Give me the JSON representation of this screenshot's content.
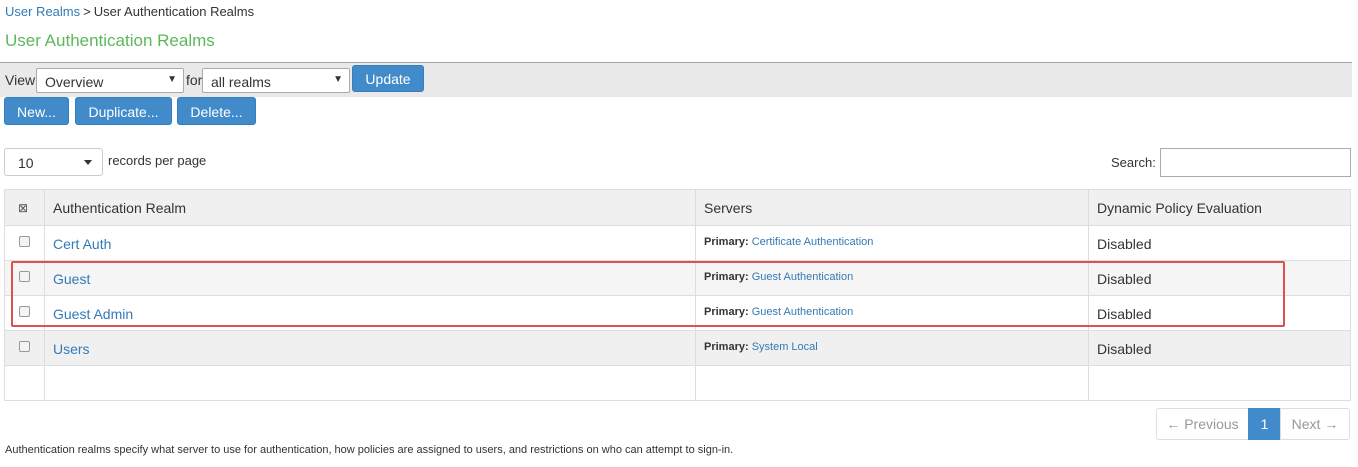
{
  "breadcrumb": {
    "root": "User Realms",
    "separator": ">",
    "current": "User Authentication Realms"
  },
  "page_title": "User Authentication Realms",
  "view_bar": {
    "view_label": "View:",
    "view_value": "Overview",
    "for_label": "for",
    "for_value": "all realms",
    "update_label": "Update"
  },
  "actions": {
    "new": "New...",
    "duplicate": "Duplicate...",
    "delete": "Delete..."
  },
  "table_controls": {
    "per_page_value": "10",
    "per_page_label": "records per page",
    "search_label": "Search:"
  },
  "table": {
    "columns": [
      "Authentication Realm",
      "Servers",
      "Dynamic Policy Evaluation"
    ],
    "rows": [
      {
        "realm": "Cert Auth",
        "server_prefix": "Primary:",
        "server": "Certificate Authentication",
        "dpe": "Disabled"
      },
      {
        "realm": "Guest",
        "server_prefix": "Primary:",
        "server": "Guest Authentication",
        "dpe": "Disabled"
      },
      {
        "realm": "Guest Admin",
        "server_prefix": "Primary:",
        "server": "Guest Authentication",
        "dpe": "Disabled"
      },
      {
        "realm": "Users",
        "server_prefix": "Primary:",
        "server": "System Local",
        "dpe": "Disabled"
      }
    ]
  },
  "pagination": {
    "previous": "← Previous",
    "current": "1",
    "next": "Next →"
  },
  "footer_text": "Authentication realms specify what server to use for authentication, how policies are assigned to users, and restrictions on who can attempt to sign-in.",
  "colors": {
    "accent": "#428bca",
    "title_green": "#5cb85c",
    "highlight_red": "#d9534f",
    "link": "#337ab7"
  }
}
